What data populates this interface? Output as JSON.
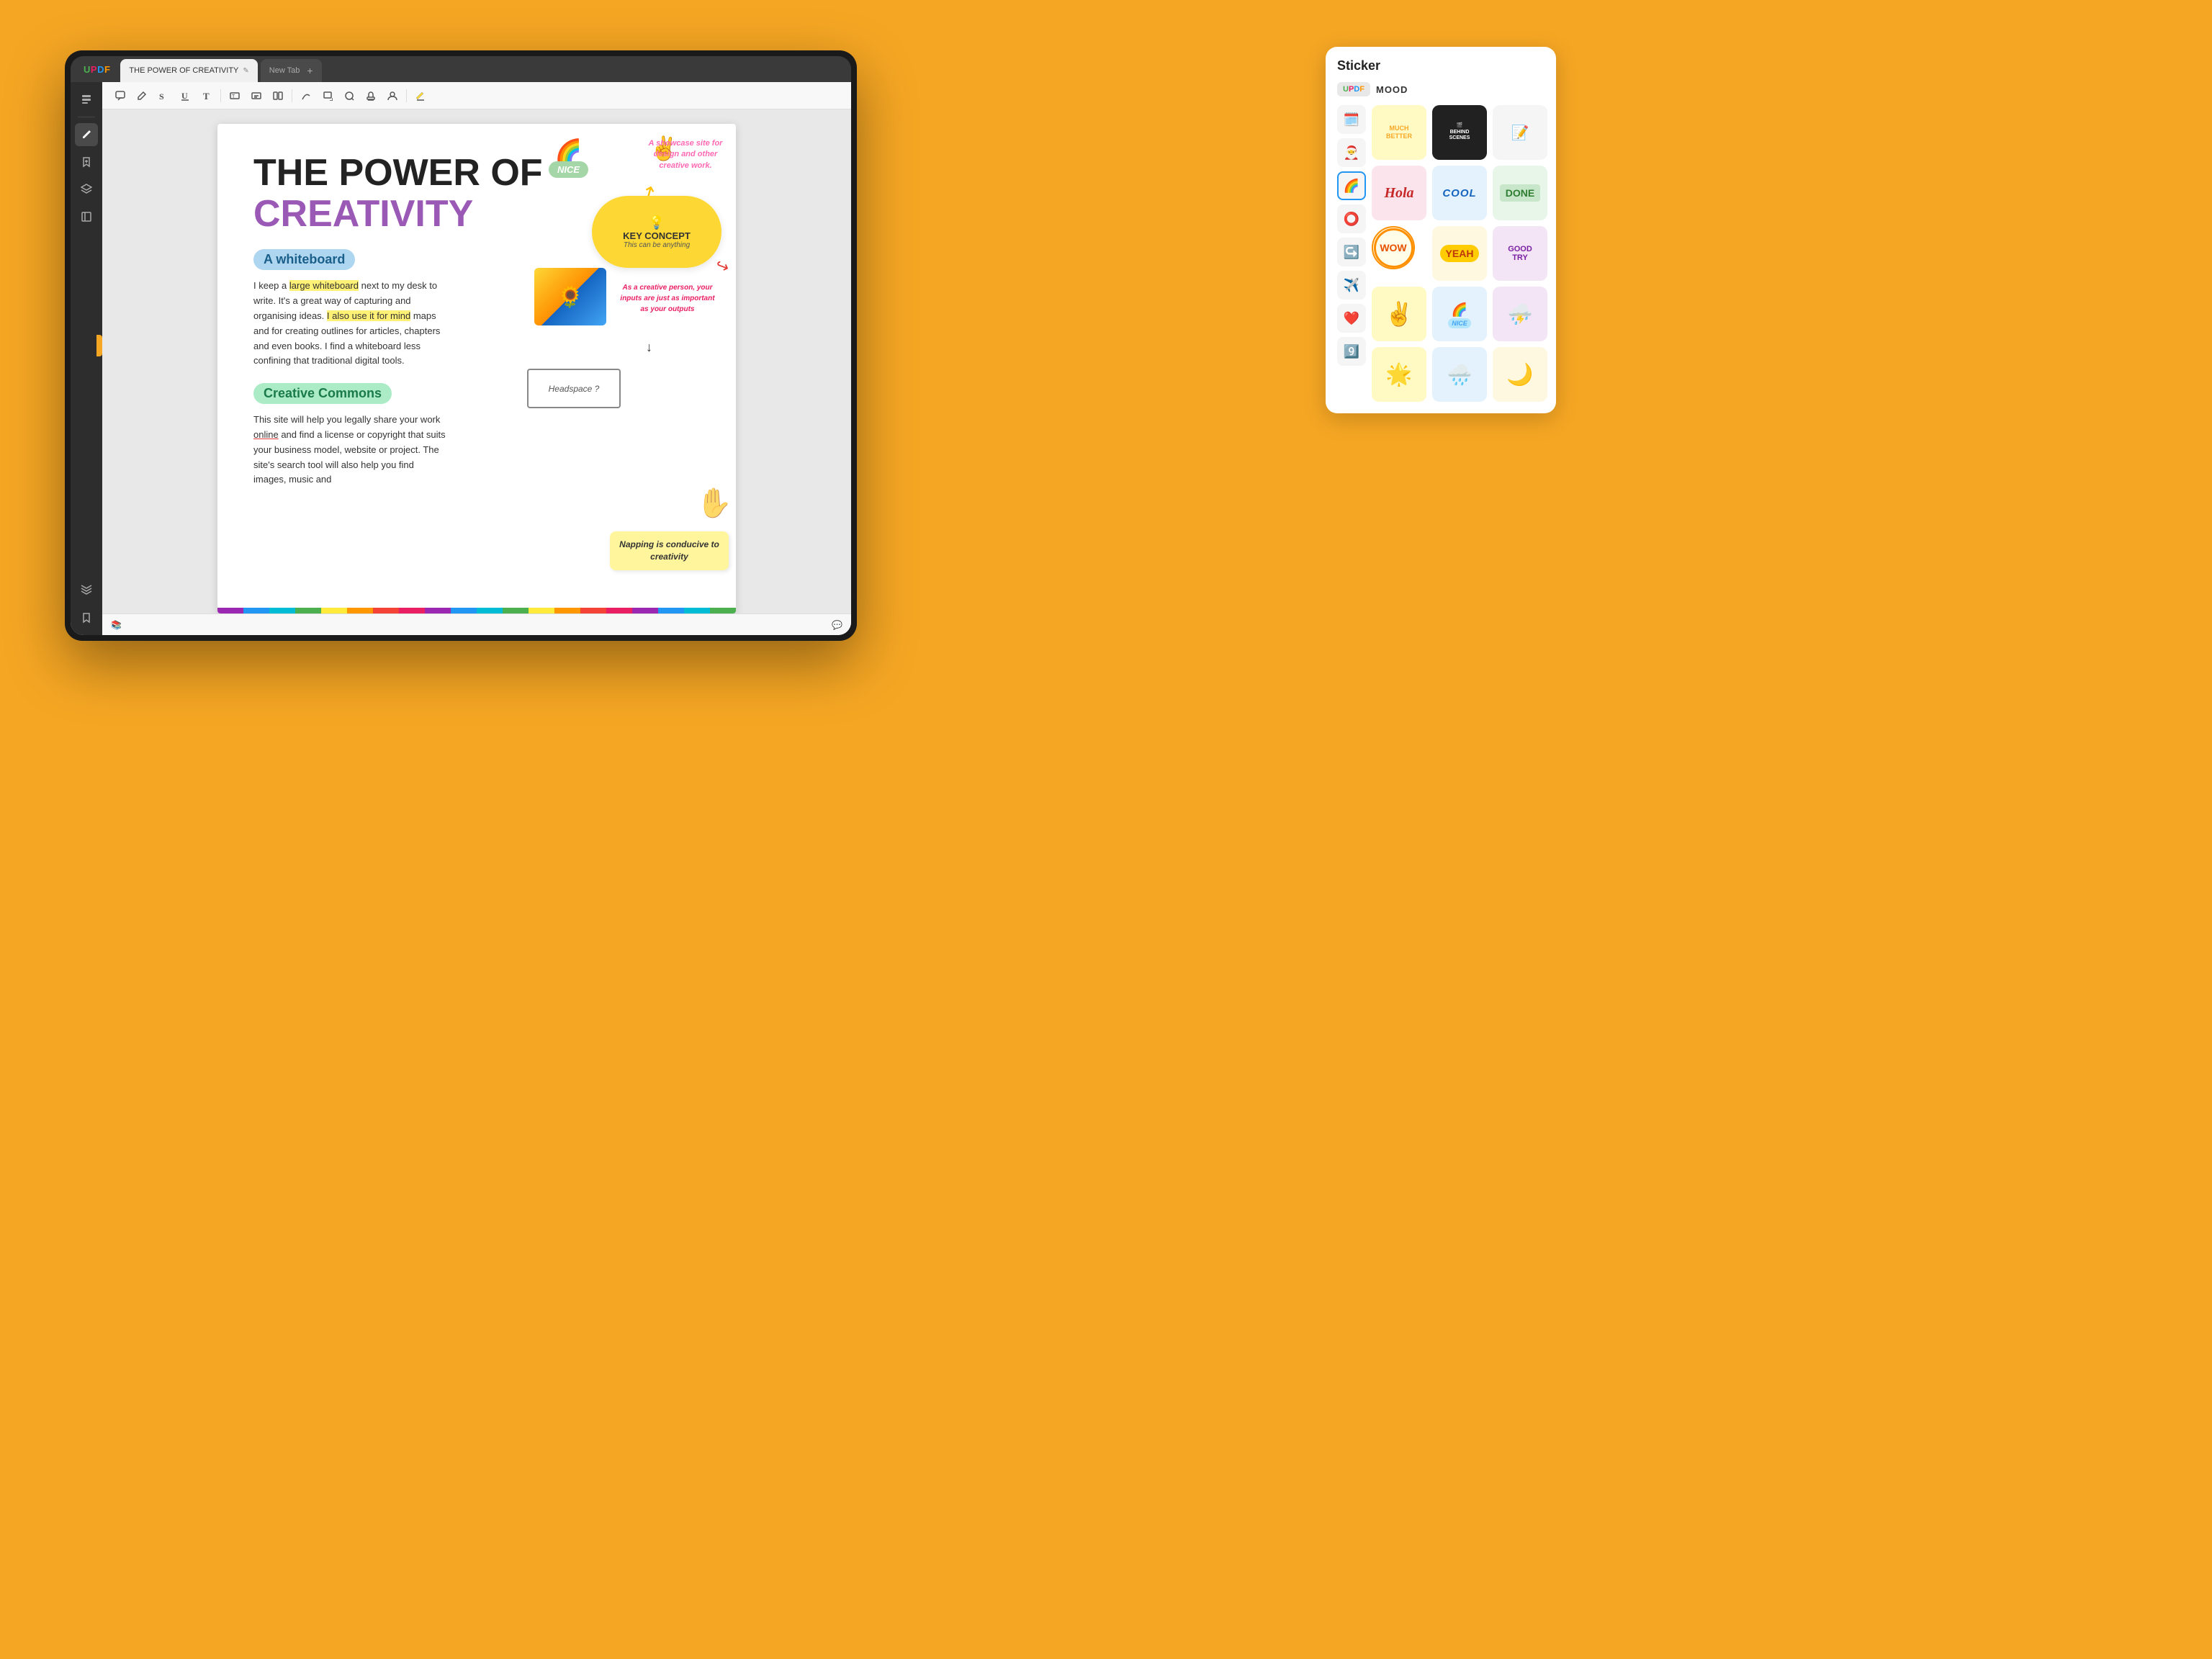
{
  "app": {
    "name": "UPDF",
    "logo_letters": [
      "U",
      "P",
      "D",
      "F"
    ]
  },
  "tabs": [
    {
      "label": "THE POWER OF CREATIVITY",
      "active": true
    },
    {
      "label": "New Tab",
      "active": false
    }
  ],
  "toolbar": {
    "tools": [
      "comment",
      "pencil",
      "strikethrough",
      "underline",
      "text",
      "text-box",
      "text-fit",
      "columns",
      "pen",
      "shape",
      "stamp",
      "person",
      "highlight"
    ]
  },
  "sidebar": {
    "icons": [
      "pages",
      "search",
      "bookmark-add",
      "layers",
      "bookmark"
    ],
    "active": "pencil"
  },
  "pdf": {
    "title_line1": "THE POWER OF",
    "title_line2": "CREATIVITY",
    "section1_label": "A whiteboard",
    "section1_body": "I keep a large whiteboard next to my desk to write. It's a great way of capturing and organising ideas. I also use it for mind maps and for creating outlines for articles, chapters and even books. I find a whiteboard less confining that traditional digital tools.",
    "section2_label": "Creative Commons",
    "section2_body": "This site will help you legally share your work online and find a license or copyright that suits your business model, website or project. The site's search tool will also help you find images, music and",
    "mindmap": {
      "nice_label": "NICE",
      "showcase_text": "A showcase site for design and other creative work.",
      "key_concept_title": "KEY CONCEPT",
      "key_concept_sub": "This can be anything",
      "creative_text": "As a creative person, your inputs are just as important as your outputs",
      "headspace_label": "Headspace ?",
      "napping_text": "Napping is conducive to creativity"
    }
  },
  "sticker_panel": {
    "title": "Sticker",
    "tab_logo": "UPDF",
    "tab_mood": "MOOD",
    "left_thumbs": [
      {
        "emoji": "🗓️",
        "active": false
      },
      {
        "emoji": "🎅",
        "active": false
      },
      {
        "emoji": "🌈",
        "active": true
      },
      {
        "emoji": "⭕",
        "active": false
      },
      {
        "emoji": "↪️",
        "active": false
      },
      {
        "emoji": "✈️",
        "active": false
      },
      {
        "emoji": "❤️",
        "active": false
      },
      {
        "emoji": "9️⃣",
        "active": false
      }
    ],
    "stickers": [
      {
        "id": "much-better",
        "label": "MUCH BETTER",
        "style": "much-better"
      },
      {
        "id": "behind-scenes",
        "label": "BEHIND THE SCENES",
        "style": "behind-scenes"
      },
      {
        "id": "notebook",
        "label": "📓",
        "style": "notebook"
      },
      {
        "id": "hola",
        "label": "Hola",
        "style": "hola"
      },
      {
        "id": "cool",
        "label": "COOL",
        "style": "cool"
      },
      {
        "id": "done",
        "label": "DONE",
        "style": "done"
      },
      {
        "id": "wow",
        "label": "WOW",
        "style": "wow"
      },
      {
        "id": "yeah",
        "label": "YEAH",
        "style": "yeah"
      },
      {
        "id": "good-try",
        "label": "GOOD TRY",
        "style": "good-try"
      },
      {
        "id": "hand-peace",
        "label": "✌️",
        "style": "hand-peace"
      },
      {
        "id": "nice-rainbow",
        "label": "🌈",
        "style": "rainbow"
      },
      {
        "id": "thunder",
        "label": "⛈️",
        "style": "thunder"
      },
      {
        "id": "sun-face",
        "label": "🌟",
        "style": "sun-face"
      },
      {
        "id": "rain-cloud",
        "label": "🌧️",
        "style": "rain-cloud"
      },
      {
        "id": "moon",
        "label": "🌙",
        "style": "moon"
      }
    ]
  },
  "bottom_bar": {
    "layers_icon": "📚",
    "chat_icon": "💬"
  }
}
